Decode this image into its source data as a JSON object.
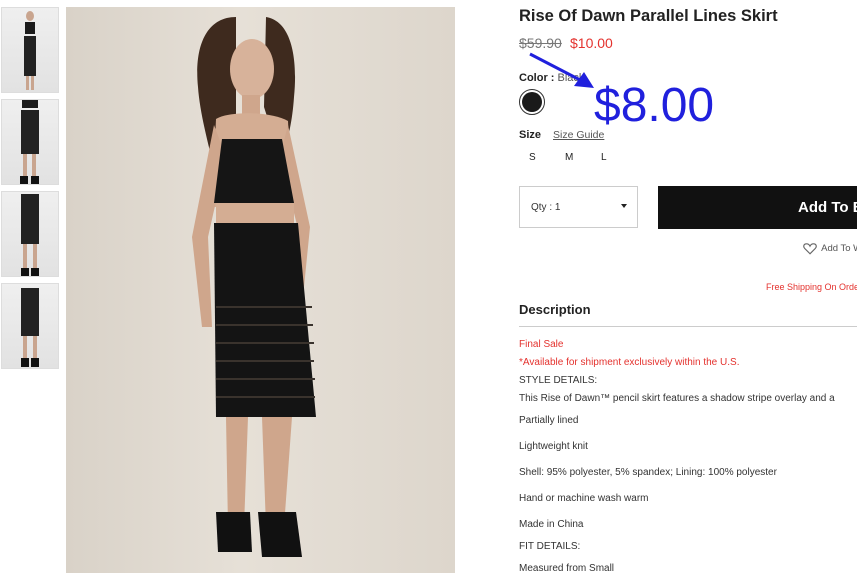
{
  "product": {
    "title": "Rise Of Dawn Parallel Lines Skirt",
    "price_original": "$59.90",
    "price_sale": "$10.00",
    "color_label": "Color :",
    "color_value": "Black",
    "swatch_color": "#1a1a1a",
    "size_label": "Size",
    "size_guide": "Size Guide",
    "sizes": [
      "S",
      "M",
      "L"
    ],
    "qty_label": "Qty : 1",
    "add_button": "Add To Bag",
    "wishlist": "Add To Wishlist",
    "shipping_note": "Free Shipping On Orders"
  },
  "description": {
    "heading": "Description",
    "final_sale": "Final Sale",
    "availability": "*Available for shipment exclusively within the U.S.",
    "style_heading": "STYLE DETAILS:",
    "body": "This Rise of Dawn™ pencil skirt features a shadow stripe overlay and a",
    "details": [
      "Partially lined",
      "Lightweight knit",
      "Shell: 95% polyester, 5% spandex; Lining: 100% polyester",
      "Hand or machine wash warm",
      "Made in China"
    ],
    "fit_heading": "FIT DETAILS:",
    "fit_line": "Measured from Small"
  },
  "annotation": {
    "price": "$8.00",
    "color": "#2020dd"
  }
}
